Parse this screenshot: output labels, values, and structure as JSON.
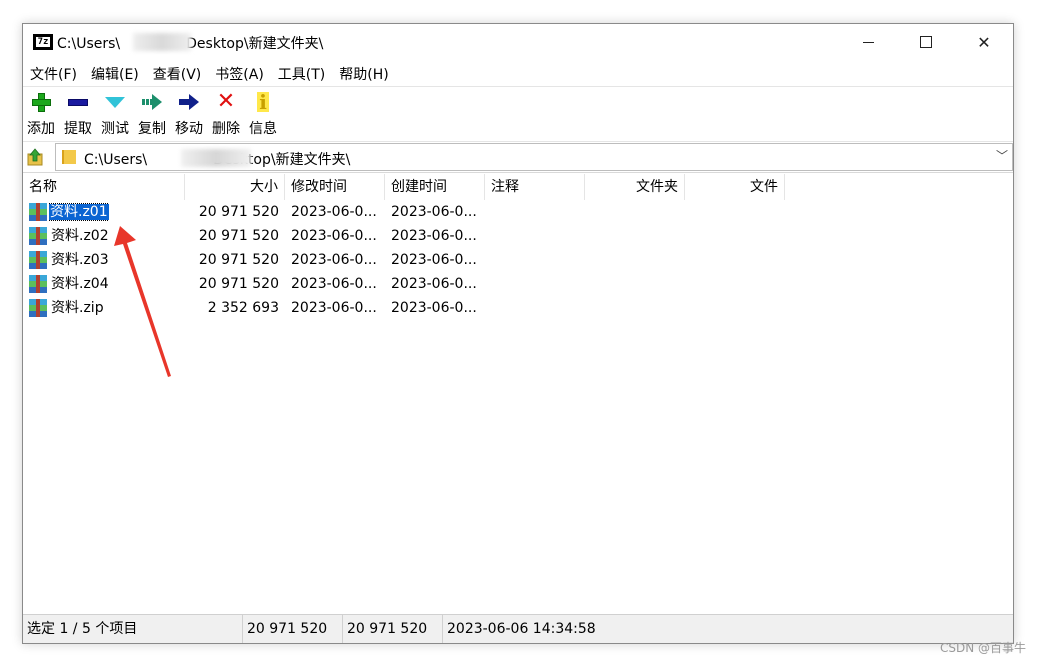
{
  "window": {
    "title": "C:\\Users\\",
    "title_suffix": "Desktop\\新建文件夹\\",
    "app_icon_label": "7z"
  },
  "menu": [
    "文件(F)",
    "编辑(E)",
    "查看(V)",
    "书签(A)",
    "工具(T)",
    "帮助(H)"
  ],
  "toolbar": [
    {
      "label": "添加",
      "icon": "add-icon"
    },
    {
      "label": "提取",
      "icon": "extract-icon"
    },
    {
      "label": "测试",
      "icon": "test-icon"
    },
    {
      "label": "复制",
      "icon": "copy-icon"
    },
    {
      "label": "移动",
      "icon": "move-icon"
    },
    {
      "label": "删除",
      "icon": "delete-icon"
    },
    {
      "label": "信息",
      "icon": "info-icon"
    }
  ],
  "address": {
    "prefix": "C:\\Users\\",
    "suffix": "Desktop\\新建文件夹\\"
  },
  "columns": {
    "name": "名称",
    "size": "大小",
    "modified": "修改时间",
    "created": "创建时间",
    "comment": "注释",
    "folders": "文件夹",
    "files": "文件"
  },
  "files": [
    {
      "name": "资料.z01",
      "size": "20 971 520",
      "modified": "2023-06-0...",
      "created": "2023-06-0...",
      "selected": true
    },
    {
      "name": "资料.z02",
      "size": "20 971 520",
      "modified": "2023-06-0...",
      "created": "2023-06-0...",
      "selected": false
    },
    {
      "name": "资料.z03",
      "size": "20 971 520",
      "modified": "2023-06-0...",
      "created": "2023-06-0...",
      "selected": false
    },
    {
      "name": "资料.z04",
      "size": "20 971 520",
      "modified": "2023-06-0...",
      "created": "2023-06-0...",
      "selected": false
    },
    {
      "name": "资料.zip",
      "size": "2 352 693",
      "modified": "2023-06-0...",
      "created": "2023-06-0...",
      "selected": false
    }
  ],
  "status": {
    "selection": "选定 1 / 5 个项目",
    "size1": "20 971 520",
    "size2": "20 971 520",
    "datetime": "2023-06-06 14:34:58"
  },
  "watermark": "CSDN @百事牛",
  "colors": {
    "selection": "#0a64d2",
    "annotation_arrow": "#e8362a"
  }
}
